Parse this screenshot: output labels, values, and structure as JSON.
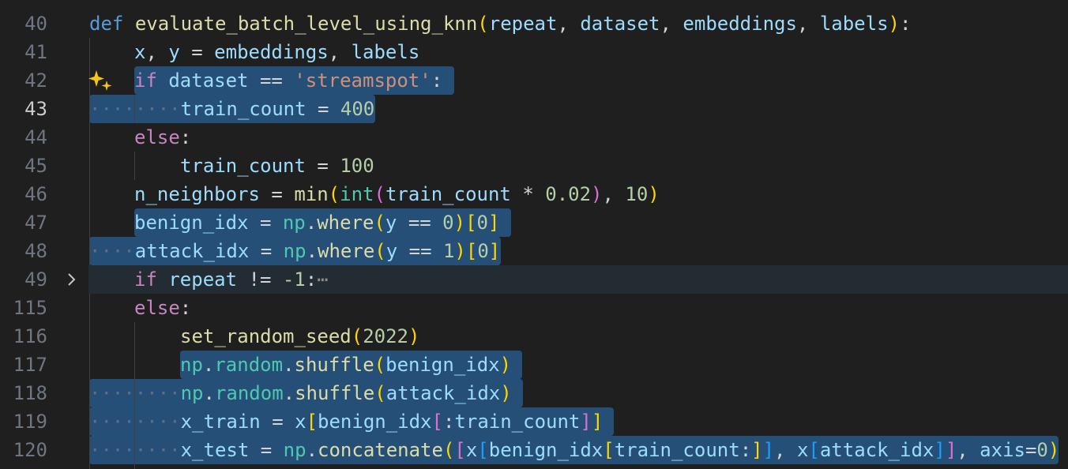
{
  "editor": {
    "line_numbers": [
      "40",
      "41",
      "42",
      "43",
      "44",
      "45",
      "46",
      "47",
      "48",
      "49",
      "115",
      "116",
      "117",
      "118",
      "119",
      "120"
    ],
    "active_line": "43",
    "lines": {
      "l40": {
        "t1": "def",
        "t2": "evaluate_batch_level_using_knn",
        "t3": "(",
        "t4": "repeat",
        "t5": ", ",
        "t6": "dataset",
        "t7": ", ",
        "t8": "embeddings",
        "t9": ", ",
        "t10": "labels",
        "t11": ")",
        "t12": ":"
      },
      "l41": {
        "t1": "x",
        "t2": ", ",
        "t3": "y",
        "t4": " = ",
        "t5": "embeddings",
        "t6": ", ",
        "t7": "labels"
      },
      "l42": {
        "t1": "if",
        "t2": " ",
        "t3": "dataset",
        "t4": " == ",
        "t5": "'streamspot'",
        "t6": ":"
      },
      "l43": {
        "t1": "train_count",
        "t2": " = ",
        "t3": "400"
      },
      "l44": {
        "t1": "else",
        "t2": ":"
      },
      "l45": {
        "t1": "train_count",
        "t2": " = ",
        "t3": "100"
      },
      "l46": {
        "t1": "n_neighbors",
        "t2": " = ",
        "t3": "min",
        "t4": "(",
        "t5": "int",
        "t6": "(",
        "t7": "train_count",
        "t8": " * ",
        "t9": "0.02",
        "t10": ")",
        "t11": ", ",
        "t12": "10",
        "t13": ")"
      },
      "l47": {
        "t1": "benign_idx",
        "t2": " = ",
        "t3": "np",
        "t4": ".",
        "t5": "where",
        "t6": "(",
        "t7": "y",
        "t8": " == ",
        "t9": "0",
        "t10": ")",
        "t11": "[",
        "t12": "0",
        "t13": "]"
      },
      "l48": {
        "t1": "attack_idx",
        "t2": " = ",
        "t3": "np",
        "t4": ".",
        "t5": "where",
        "t6": "(",
        "t7": "y",
        "t8": " == ",
        "t9": "1",
        "t10": ")",
        "t11": "[",
        "t12": "0",
        "t13": "]"
      },
      "l49": {
        "t1": "if",
        "t2": " ",
        "t3": "repeat",
        "t4": " != ",
        "t5": "-1",
        "t6": ":",
        "t7": "⋯"
      },
      "l115": {
        "t1": "else",
        "t2": ":"
      },
      "l116": {
        "t1": "set_random_seed",
        "t2": "(",
        "t3": "2022",
        "t4": ")"
      },
      "l117": {
        "t1": "np",
        "t2": ".",
        "t3": "random",
        "t4": ".",
        "t5": "shuffle",
        "t6": "(",
        "t7": "benign_idx",
        "t8": ")"
      },
      "l118": {
        "t1": "np",
        "t2": ".",
        "t3": "random",
        "t4": ".",
        "t5": "shuffle",
        "t6": "(",
        "t7": "attack_idx",
        "t8": ")"
      },
      "l119": {
        "t1": "x_train",
        "t2": " = ",
        "t3": "x",
        "t4": "[",
        "t5": "benign_idx",
        "t6": "[",
        "t7": ":",
        "t8": "train_count",
        "t9": "]",
        "t10": "]"
      },
      "l120": {
        "t1": "x_test",
        "t2": " = ",
        "t3": "np",
        "t4": ".",
        "t5": "concatenate",
        "t6": "(",
        "t7": "[",
        "t8": "x",
        "t9": "[",
        "t10": "benign_idx",
        "t11": "[",
        "t12": "train_count",
        "t13": ":",
        "t14": "]",
        "t15": "]",
        "t16": ", ",
        "t17": "x",
        "t18": "[",
        "t19": "attack_idx",
        "t20": "]",
        "t21": "]",
        "t22": ", ",
        "t23": "axis",
        "t24": "=",
        "t25": "0",
        "t26": ")"
      }
    },
    "whitespace_dots": {
      "d1": "····",
      "d2": "········"
    },
    "icons": {
      "fold": "chevron-right-icon",
      "ai": "sparkle-icon"
    },
    "colors": {
      "background": "#1f1f1f",
      "selection": "#264f78",
      "keyword": "#569cd6",
      "control": "#c586c0",
      "function": "#dcdcaa",
      "variable": "#9cdcfe",
      "string": "#ce9178",
      "number": "#b5cea8",
      "module": "#4ec9b0"
    }
  }
}
